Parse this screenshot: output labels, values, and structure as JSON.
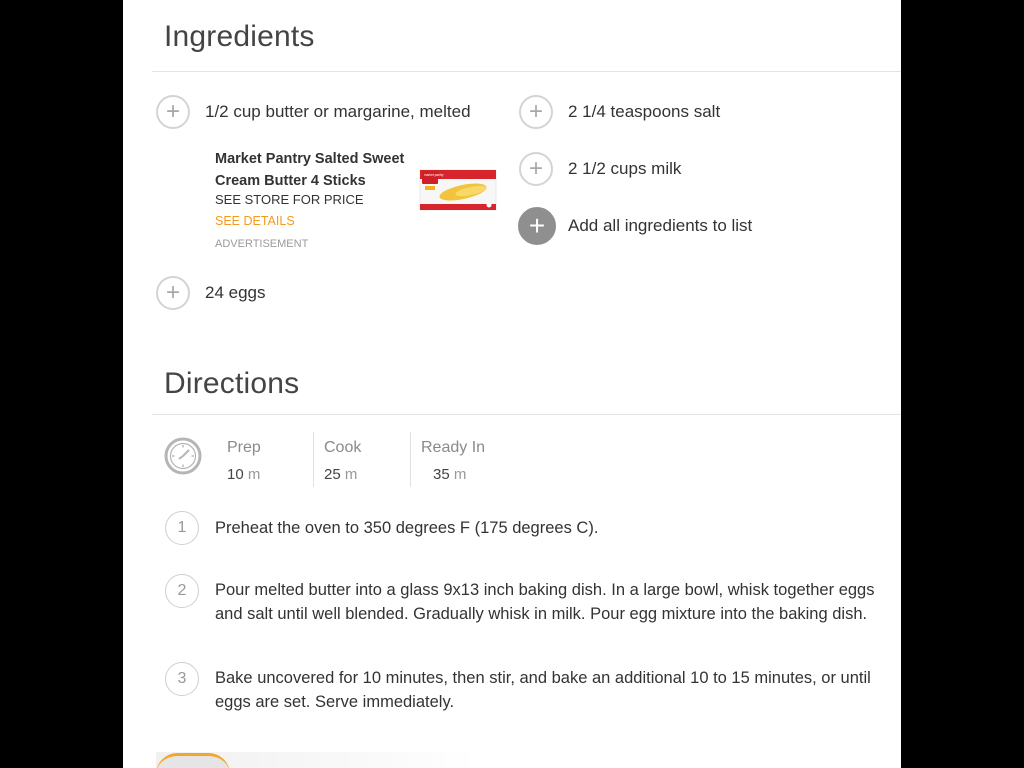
{
  "ingredients_section": {
    "title": "Ingredients",
    "left_items": [
      "1/2 cup butter or margarine, melted",
      "24 eggs"
    ],
    "right_items": [
      "2 1/4 teaspoons salt",
      "2 1/2 cups milk"
    ],
    "add_all_label": "Add all ingredients to list",
    "ad": {
      "title": "Market Pantry Salted Sweet Cream Butter 4 Sticks",
      "price_text": "SEE STORE FOR PRICE",
      "link_text": "SEE DETAILS",
      "note": "ADVERTISEMENT",
      "image_brand_text": "market pantry",
      "link_color": "#f59a1d"
    },
    "plus_icon": "+"
  },
  "directions_section": {
    "title": "Directions",
    "times": [
      {
        "label": "Prep",
        "value": "10",
        "unit": "m"
      },
      {
        "label": "Cook",
        "value": "25",
        "unit": "m"
      },
      {
        "label": "Ready In",
        "value": "35",
        "unit": "m"
      }
    ],
    "steps": [
      {
        "number": "1",
        "text": "Preheat the oven to 350 degrees F (175 degrees C)."
      },
      {
        "number": "2",
        "text": "Pour melted butter into a glass 9x13 inch baking dish. In a large bowl, whisk together eggs and salt until well blended. Gradually whisk in milk. Pour egg mixture into the baking dish."
      },
      {
        "number": "3",
        "text": "Bake uncovered for 10 minutes, then stir, and bake an additional 10 to 15 minutes, or until eggs are set. Serve immediately."
      }
    ]
  },
  "colors": {
    "accent_orange": "#f59a1d",
    "icon_gray": "#8f8f8f"
  }
}
